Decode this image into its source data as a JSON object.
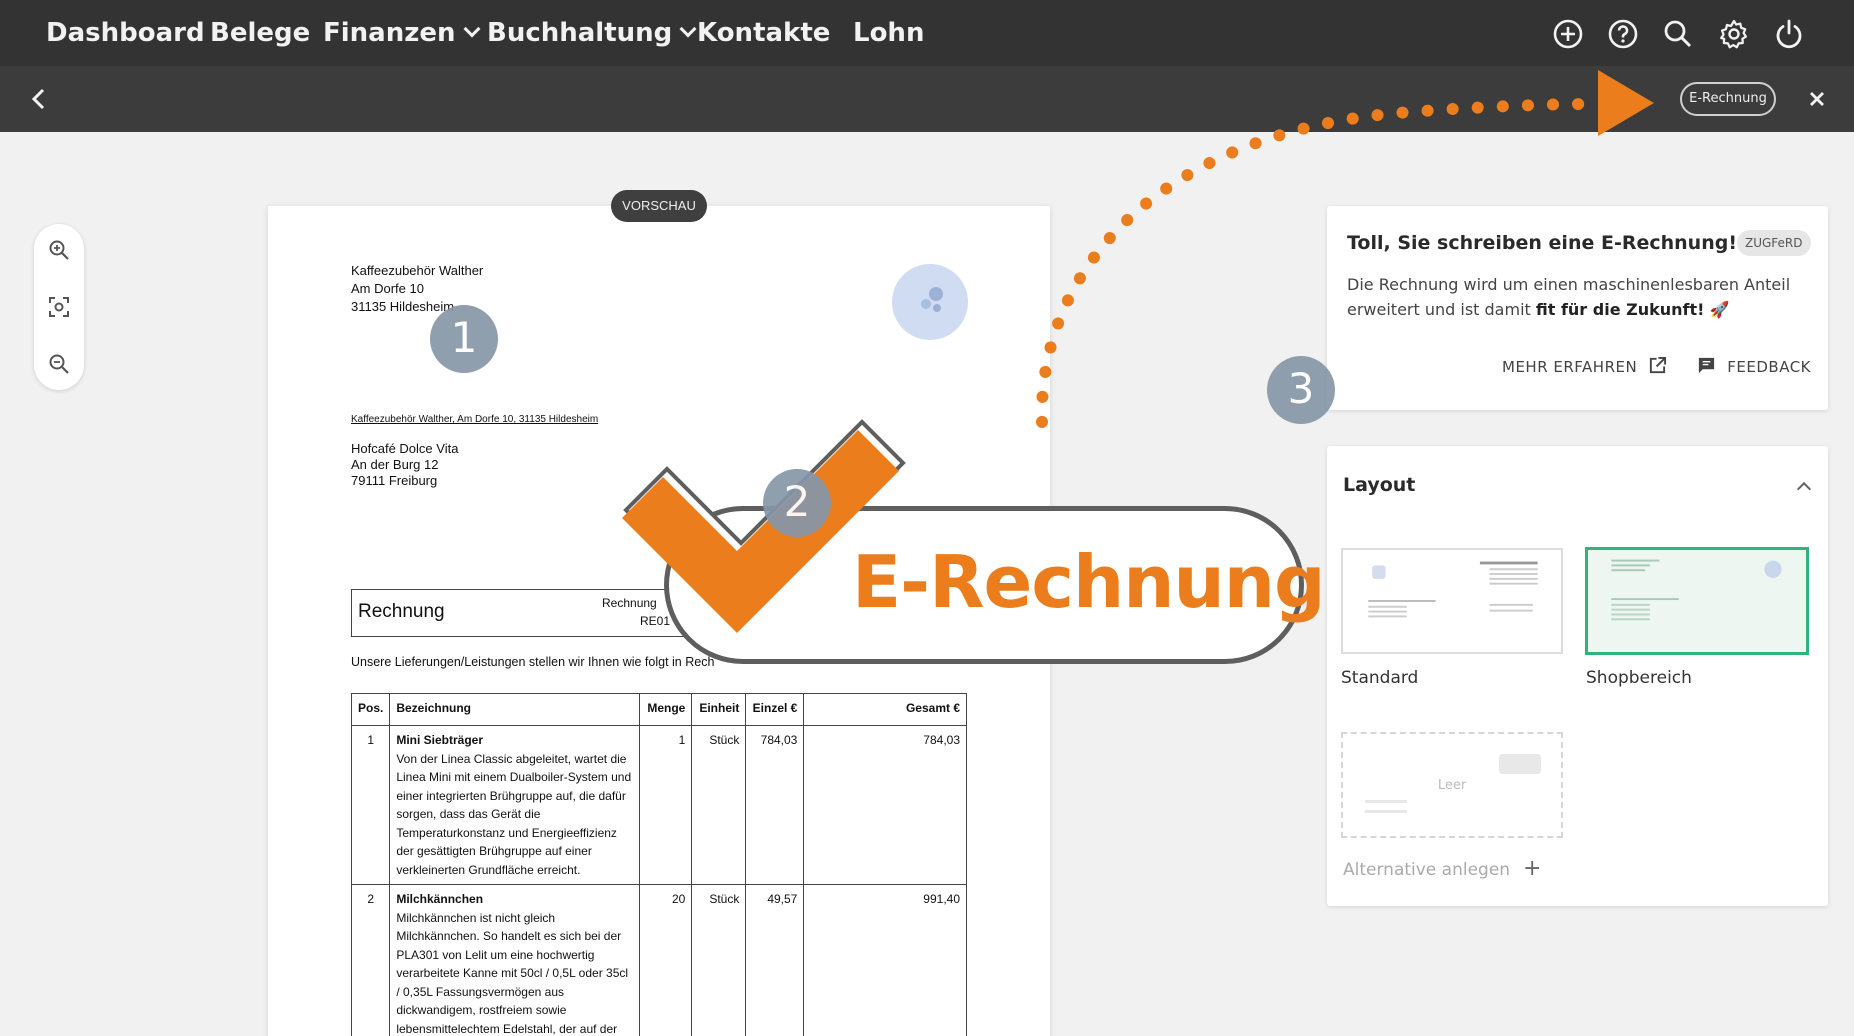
{
  "nav": {
    "items": [
      {
        "label": "Dashboard",
        "has_menu": false
      },
      {
        "label": "Belege",
        "has_menu": false
      },
      {
        "label": "Finanzen",
        "has_menu": true
      },
      {
        "label": "Buchhaltung",
        "has_menu": true
      },
      {
        "label": "Kontakte",
        "has_menu": false
      },
      {
        "label": "Lohn",
        "has_menu": false
      }
    ],
    "icons": [
      "add-circle-icon",
      "help-icon",
      "search-icon",
      "settings-gear-icon",
      "power-icon"
    ]
  },
  "subbar": {
    "back_icon": "chevron-left-icon",
    "pill_label": "E-Rechnung",
    "close_icon": "close-icon"
  },
  "zoom": {
    "icons": [
      "zoom-in-icon",
      "fit-screen-icon",
      "zoom-out-icon"
    ]
  },
  "preview": {
    "badge": "VORSCHAU",
    "sender": {
      "line1": "Kaffeezubehör Walther",
      "line2": "Am Dorfe 10",
      "line3": "31135 Hildesheim"
    },
    "sender_line": "Kaffeezubehör Walther, Am Dorfe 10, 31135 Hildesheim",
    "recipient": {
      "line1": "Hofcafé Dolce Vita",
      "line2": "An der Burg 12",
      "line3": "79111 Freiburg"
    },
    "invoice_title": "Rechnung",
    "invoice_nr_label": "Rechnung",
    "invoice_nr_value": "RE01",
    "intro": "Unsere Lieferungen/Leistungen stellen wir Ihnen wie folgt in Rech",
    "table": {
      "headers": [
        "Pos.",
        "Bezeichnung",
        "Menge",
        "Einheit",
        "Einzel €",
        "Gesamt €"
      ],
      "rows": [
        {
          "pos": "1",
          "name": "Mini Siebträger",
          "desc": "Von der Linea Classic abgeleitet, wartet die Linea Mini mit einem Dualboiler-System und einer integrierten Brühgruppe auf, die dafür sorgen, dass das Gerät die Temperaturkonstanz und Energieeffizienz der gesättigten Brühgruppe auf einer verkleinerten Grundfläche erreicht.",
          "qty": "1",
          "unit": "Stück",
          "price": "784,03",
          "total": "784,03"
        },
        {
          "pos": "2",
          "name": "Milchkännchen",
          "desc": "Milchkännchen ist nicht gleich Milchkännchen. So handelt es sich bei der PLA301 von Lelit um eine hochwertig verarbeitete Kanne mit 50cl / 0,5L oder 35cl / 0,35L Fassungsvermögen aus dickwandigem, rostfreiem sowie lebensmittelechtem Edelstahl, der auf der Außenseite auf Hochglanz poliert wurde. Die",
          "qty": "20",
          "unit": "Stück",
          "price": "49,57",
          "total": "991,40"
        }
      ]
    }
  },
  "info_card": {
    "title": "Toll, Sie schreiben eine E-Rechnung!",
    "badge": "ZUGFeRD",
    "body_prefix": "Die Rechnung wird um einen maschinenlesbaren Anteil erweitert und ist damit ",
    "body_bold": "fit für die Zukunft!",
    "body_emoji": "🚀",
    "learn_more": "MEHR ERFAHREN",
    "feedback": "FEEDBACK"
  },
  "layout_card": {
    "title": "Layout",
    "options": [
      {
        "label": "Standard",
        "selected": false
      },
      {
        "label": "Shopbereich",
        "selected": true
      }
    ],
    "empty_label": "Leer",
    "alternative": "Alternative anlegen"
  },
  "overlay": {
    "stamp_text": "E-Rechnung",
    "markers": [
      "1",
      "2",
      "3"
    ],
    "accent": "#ec7d1c",
    "marker_color": "#8797a8"
  },
  "colors": {
    "topbar": "#333333",
    "subbar": "#3c3c3c",
    "selected_layout": "#2fb47c"
  }
}
